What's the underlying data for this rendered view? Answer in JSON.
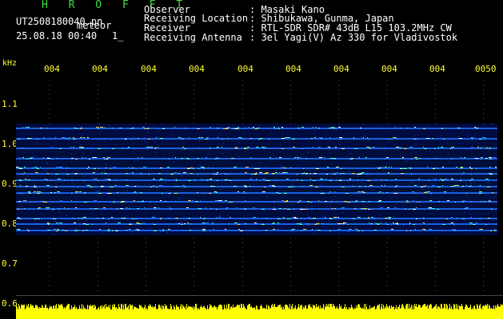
{
  "header": {
    "brand": "H R O F F T",
    "filename": "UT2508180040.pn",
    "meteor_label": "meteor",
    "timestamp": "25.08.18 00:40",
    "index": "1_",
    "rows": [
      {
        "label": "Observer",
        "value": ": Masaki Kano"
      },
      {
        "label": "Receiving Location",
        "value": ": Shibukawa, Gunma, Japan"
      },
      {
        "label": "Receiver",
        "value": ": RTL-SDR SDR# 43dB L15 103.2MHz CW"
      },
      {
        "label": "Receiving Antenna",
        "value": ": 3el Yagi(V) Az 330 for Vladivostok"
      }
    ]
  },
  "axes": {
    "y_unit": "kHz",
    "y_ticks": [
      "1.1",
      "1.0",
      "0.9",
      "0.8",
      "0.7",
      "0.6"
    ],
    "x_ticks": [
      "004",
      "004",
      "004",
      "004",
      "004",
      "004",
      "004",
      "004",
      "004",
      "0050"
    ]
  },
  "colors": {
    "text": "#ffffff",
    "brand": "#3fe03f",
    "tick": "#ffff33",
    "amplitude": "#ffff00",
    "background": "#000000"
  }
}
